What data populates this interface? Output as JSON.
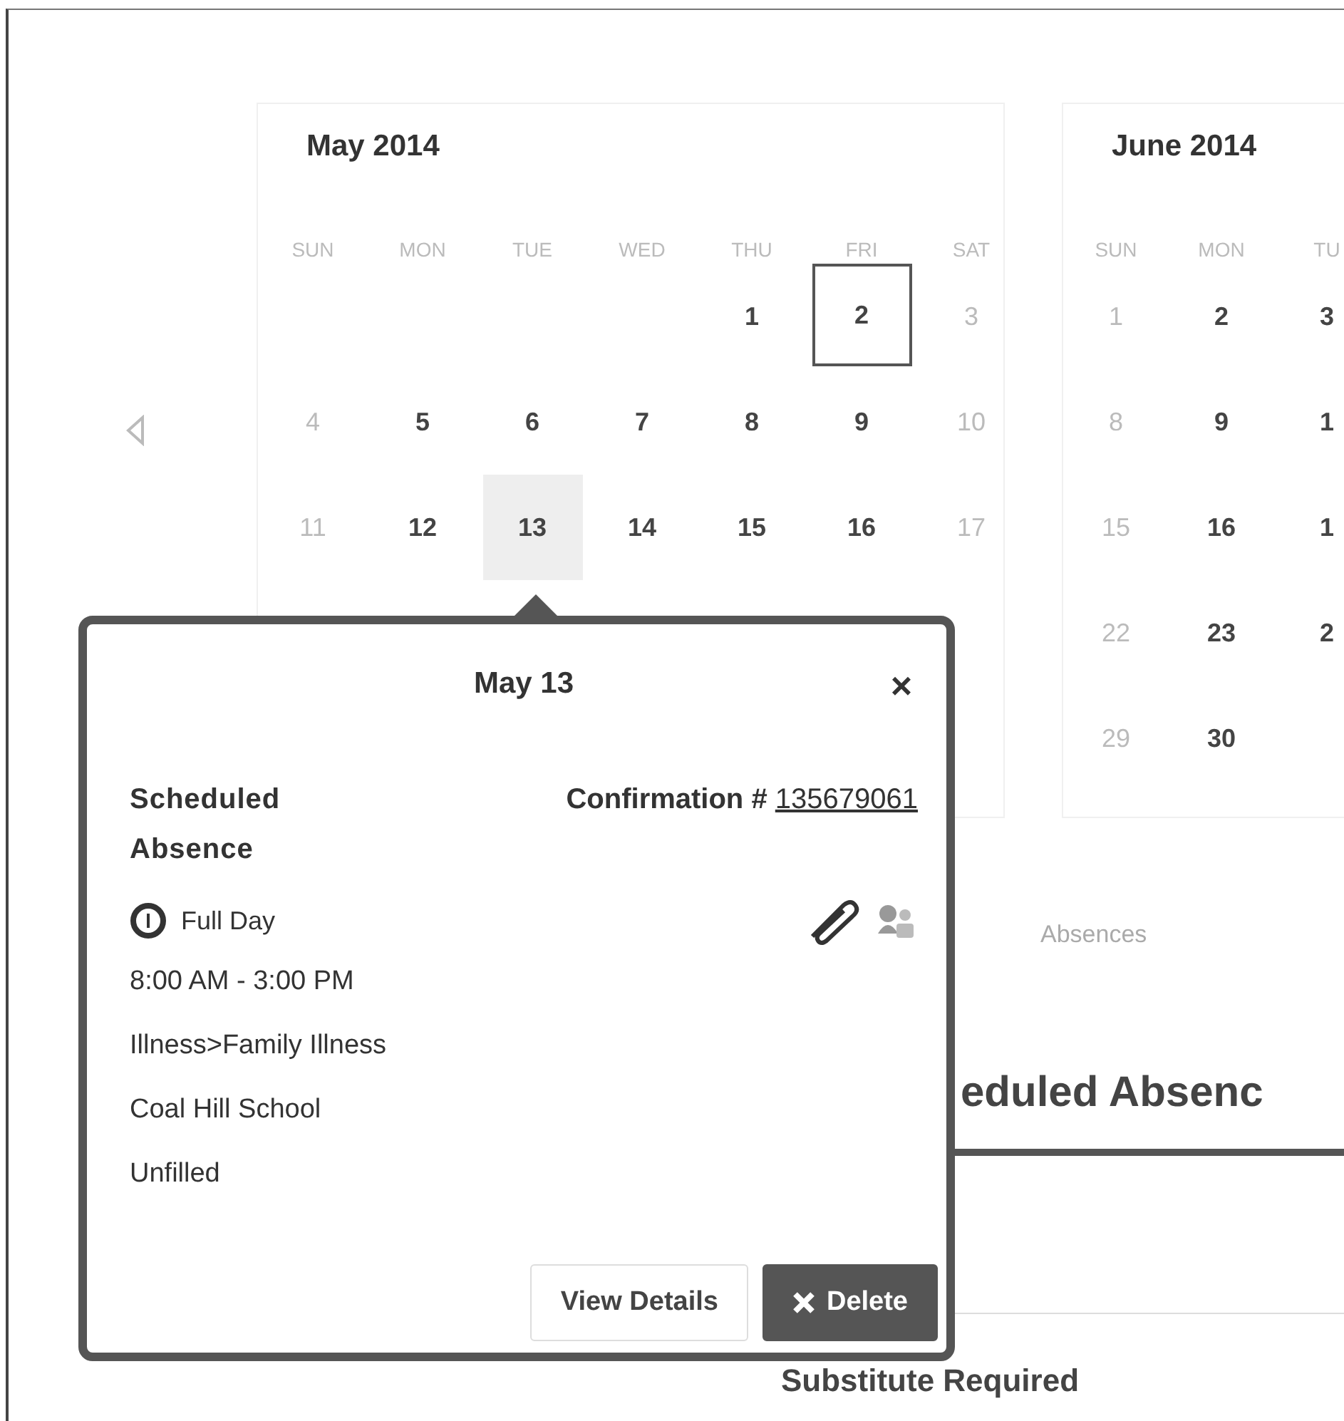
{
  "calendars": [
    {
      "title": "May 2014",
      "weekdays": [
        "SUN",
        "MON",
        "TUE",
        "WED",
        "THU",
        "FRI",
        "SAT"
      ],
      "weeks": [
        [
          {
            "day": "1",
            "today": false,
            "selected": false
          },
          {
            "day": "2",
            "today": true,
            "selected": false
          },
          {
            "day": "3",
            "today": false,
            "selected": false
          }
        ],
        [
          {
            "day": "4",
            "today": false,
            "selected": false
          },
          {
            "day": "5",
            "today": false,
            "selected": false
          },
          {
            "day": "6",
            "today": false,
            "selected": false
          },
          {
            "day": "7",
            "today": false,
            "selected": false
          },
          {
            "day": "8",
            "today": false,
            "selected": false
          },
          {
            "day": "9",
            "today": false,
            "selected": false
          },
          {
            "day": "10",
            "today": false,
            "selected": false
          }
        ],
        [
          {
            "day": "11",
            "today": false,
            "selected": false
          },
          {
            "day": "12",
            "today": false,
            "selected": false
          },
          {
            "day": "13",
            "today": false,
            "selected": true
          },
          {
            "day": "14",
            "today": false,
            "selected": false
          },
          {
            "day": "15",
            "today": false,
            "selected": false
          },
          {
            "day": "16",
            "today": false,
            "selected": false
          },
          {
            "day": "17",
            "today": false,
            "selected": false
          }
        ]
      ]
    },
    {
      "title": "June 2014",
      "weekdays": [
        "SUN",
        "MON",
        "TU"
      ],
      "weeks": [
        [
          {
            "day": "1",
            "today": false,
            "selected": false
          },
          {
            "day": "2",
            "today": false,
            "selected": false
          },
          {
            "day": "3",
            "today": false,
            "selected": false
          }
        ],
        [
          {
            "day": "8",
            "today": false,
            "selected": false
          },
          {
            "day": "9",
            "today": false,
            "selected": false
          },
          {
            "day": "1",
            "today": false,
            "selected": false
          }
        ],
        [
          {
            "day": "15",
            "today": false,
            "selected": false
          },
          {
            "day": "16",
            "today": false,
            "selected": false
          },
          {
            "day": "1",
            "today": false,
            "selected": false
          }
        ],
        [
          {
            "day": "22",
            "today": false,
            "selected": false
          },
          {
            "day": "23",
            "today": false,
            "selected": false
          },
          {
            "day": "2",
            "today": false,
            "selected": false
          }
        ],
        [
          {
            "day": "29",
            "today": false,
            "selected": false
          },
          {
            "day": "30",
            "today": false,
            "selected": false
          }
        ]
      ]
    }
  ],
  "popover": {
    "title": "May 13",
    "close": "×",
    "heading": "Scheduled Absence",
    "confirmation_label": "Confirmation #",
    "confirmation_number": "135679061",
    "duration": "Full Day",
    "time": "8:00 AM - 3:00 PM",
    "reason": "Illness>Family Illness",
    "location": "Coal Hill School",
    "status": "Unfilled",
    "buttons": [
      {
        "label": "View Details",
        "kind": "default"
      },
      {
        "label": "Delete",
        "kind": "danger"
      }
    ]
  },
  "tab": {
    "label": "Absences"
  },
  "section_heading": "eduled Absenc",
  "subheading": "Substitute Required"
}
